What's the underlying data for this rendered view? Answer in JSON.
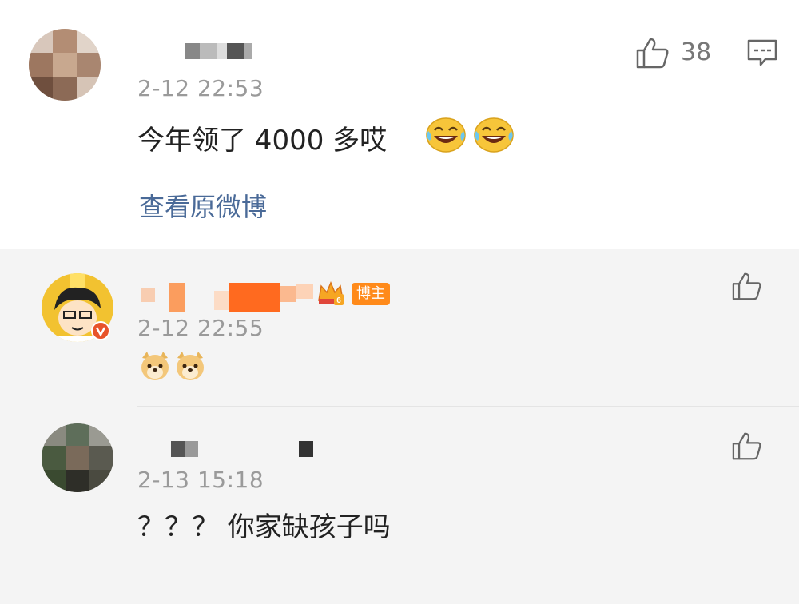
{
  "main_comment": {
    "timestamp": "2-12 22:53",
    "text": "今年领了 4000 多哎",
    "emojis": [
      "laugh-cry-emoji",
      "laugh-cry-emoji"
    ],
    "like_count": "38",
    "view_original_link": "查看原微博"
  },
  "replies": [
    {
      "timestamp": "2-12 22:55",
      "badge": "博主",
      "emojis": [
        "doge-emoji",
        "doge-emoji"
      ]
    },
    {
      "timestamp": "2-13 15:18",
      "text": "？？？ 你家缺孩子吗"
    }
  ],
  "icons": {
    "like": "thumbs-up-icon",
    "comment": "comment-icon",
    "verified": "verified-v-icon",
    "vip": "crown-level-icon"
  },
  "colors": {
    "link": "#4a6a98",
    "badge": "#ff8a1a",
    "verified": "#e8542a"
  }
}
